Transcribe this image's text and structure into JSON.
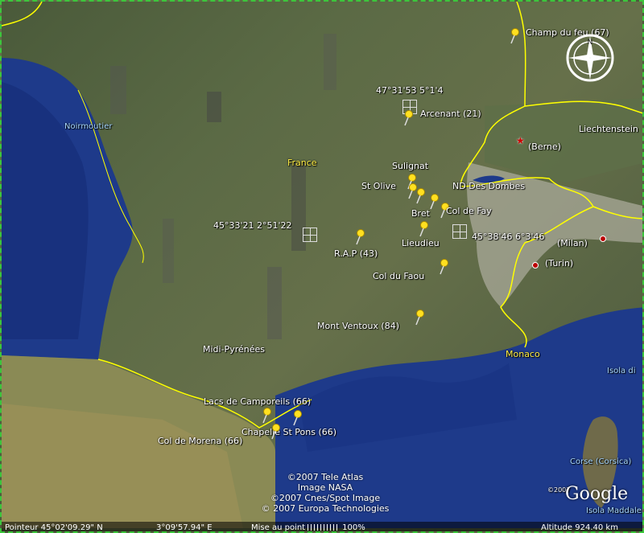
{
  "colors": {
    "border_line": "#ffff00",
    "sea": "#1e3a8a",
    "pin": "#ffe020",
    "label": "#ffffff"
  },
  "places": {
    "noirmoutier": "Noirmoutier",
    "france": "France",
    "liechtenstein": "Liechtenstein",
    "berne": "(Berne)",
    "milan": "(Milan)",
    "turin": "(Turin)",
    "monaco": "Monaco",
    "midi_pyrenees": "Midi-Pyrénées",
    "corse": "Corse (Corsica)",
    "isola_di": "Isola di",
    "isola_maddalena": "Isola Maddalen"
  },
  "pins": [
    {
      "label": "Champ du feu (67)"
    },
    {
      "label": "Arcenant (21)"
    },
    {
      "label": "Sulignat"
    },
    {
      "label": "St Olive"
    },
    {
      "label": "ND Des Dombes"
    },
    {
      "label": "Bret"
    },
    {
      "label": "Col de Fay"
    },
    {
      "label": "Lieudieu"
    },
    {
      "label": "R.A.P (43)"
    },
    {
      "label": "Col du Faou"
    },
    {
      "label": "Mont Ventoux (84)"
    },
    {
      "label": "Lacs de Camporeils (66)"
    },
    {
      "label": "Chapelle St Pons (66)"
    },
    {
      "label": "Col de Morena (66)"
    }
  ],
  "coords": {
    "c1": "47°31'53 5°1'4",
    "c2": "45°33'21 2°51'22",
    "c3": "45°38'46 6°3'46"
  },
  "credits": [
    "©2007 Tele Atlas",
    "Image NASA",
    "©2007 Cnes/Spot Image",
    "© 2007 Europa Technologies"
  ],
  "corner_credit": "©2007",
  "brand": "Google",
  "status": {
    "pointer": "Pointeur 45°02'09.29\" N",
    "lon": "3°09'57.94\" E",
    "streaming_label": "Mise au point",
    "streaming_pct": "100%",
    "altitude": "Altitude   924.40 km"
  }
}
